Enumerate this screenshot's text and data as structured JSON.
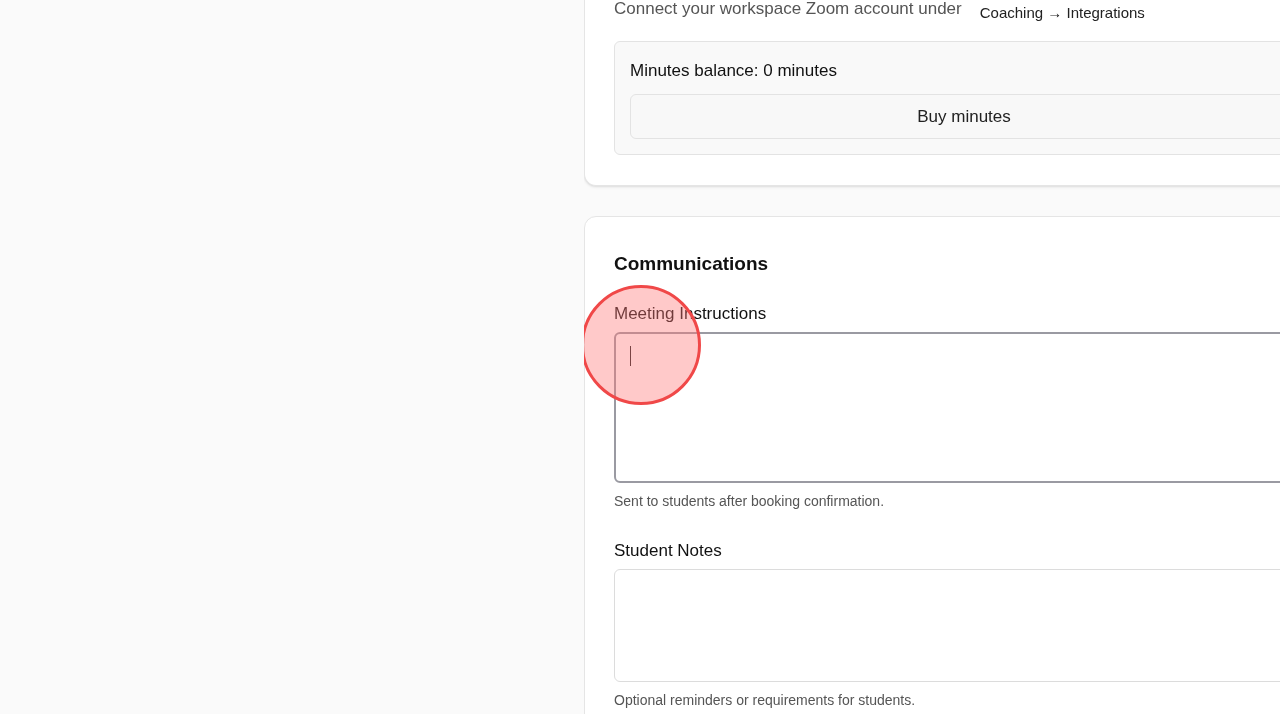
{
  "zoom_card": {
    "intro": "Connect your workspace Zoom account under",
    "path": "Coaching → Integrations",
    "balance": "Minutes balance: 0 minutes",
    "buy_button": "Buy minutes"
  },
  "communications": {
    "title": "Communications",
    "fields": [
      {
        "label": "Meeting Instructions",
        "focused": true,
        "click_highlight": true,
        "hint": "Sent to students after booking confirmation."
      },
      {
        "label": "Student Notes",
        "focused": false,
        "click_highlight": false,
        "hint": "Optional reminders or requirements for students."
      }
    ]
  }
}
